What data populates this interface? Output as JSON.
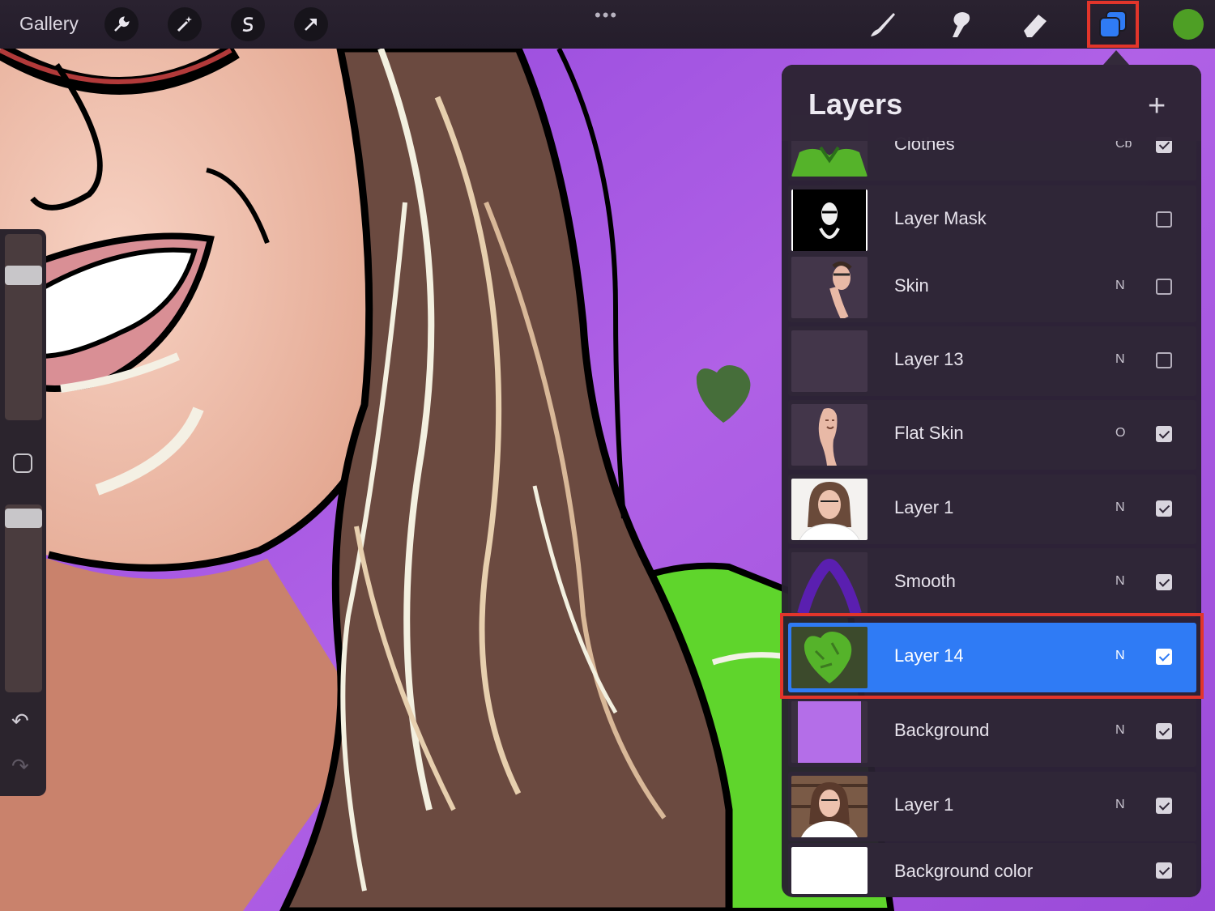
{
  "topbar": {
    "gallery_label": "Gallery",
    "tools_left": [
      "wrench-icon",
      "magic-wand-icon",
      "selection-icon",
      "transform-arrow-icon"
    ],
    "more_label": "•••",
    "tools_right": [
      "brush-icon",
      "smudge-icon",
      "eraser-icon",
      "layers-icon"
    ],
    "current_color": "#4e9f25"
  },
  "sidebar": {
    "undo_label": "↶",
    "redo_label": "↷"
  },
  "layers_panel": {
    "title": "Layers",
    "add_label": "+",
    "layers": [
      {
        "name": "Clothes",
        "blend": "Cb",
        "visible": true
      },
      {
        "name": "Layer Mask",
        "blend": "",
        "visible": false
      },
      {
        "name": "Skin",
        "blend": "N",
        "visible": false
      },
      {
        "name": "Layer 13",
        "blend": "N",
        "visible": false
      },
      {
        "name": "Flat Skin",
        "blend": "O",
        "visible": true
      },
      {
        "name": "Layer 1",
        "blend": "N",
        "visible": true
      },
      {
        "name": "Smooth",
        "blend": "N",
        "visible": true
      },
      {
        "name": "Layer 14",
        "blend": "N",
        "visible": true,
        "selected": true
      },
      {
        "name": "Background",
        "blend": "N",
        "visible": true
      },
      {
        "name": "Layer 1",
        "blend": "N",
        "visible": true
      },
      {
        "name": "Background color",
        "blend": "",
        "visible": true
      }
    ]
  },
  "colors": {
    "selection_blue": "#2f7bf5",
    "highlight_red": "#e2352b",
    "canvas_purple": "#a44fe0"
  }
}
